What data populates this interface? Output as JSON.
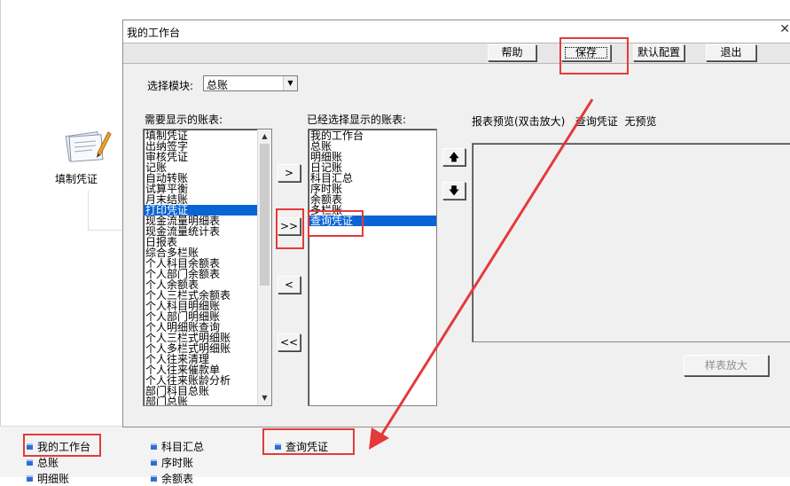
{
  "background": {
    "desktop_icon_label": "填制凭证",
    "bottom_items": [
      "我的工作台",
      "总账",
      "明细账",
      "科目汇总",
      "序时账",
      "余额表",
      "查询凭证"
    ]
  },
  "dialog": {
    "title": "我的工作台",
    "toolbar": {
      "help": "帮助",
      "save": "保存",
      "default": "默认配置",
      "exit": "退出"
    },
    "module_label": "选择模块:",
    "module_value": "总账",
    "available_label": "需要显示的账表:",
    "available_items": [
      "填制凭证",
      "出纳签字",
      "审核凭证",
      "记账",
      "自动转账",
      "试算平衡",
      "月末结账",
      "打印凭证",
      "现金流量明细表",
      "现金流量统计表",
      "日报表",
      "综合多栏账",
      "个人科目余额表",
      "个人部门余额表",
      "个人余额表",
      "个人三栏式余额表",
      "个人科目明细账",
      "个人部门明细账",
      "个人明细账查询",
      "个人三栏式明细账",
      "个人多栏式明细账",
      "个人往来清理",
      "个人往来催款单",
      "个人往来账龄分析",
      "部门科目总账",
      "部门总账"
    ],
    "available_selected": "打印凭证",
    "selected_label": "已经选择显示的账表:",
    "selected_items": [
      "我的工作台",
      "总账",
      "明细账",
      "日记账",
      "科目汇总",
      "序时账",
      "余额表",
      "多栏账",
      "查询凭证"
    ],
    "selected_selected": "查询凭证",
    "move_buttons": {
      "add": ">",
      "add_all": ">>",
      "remove": "<",
      "remove_all": "<<"
    },
    "preview_label": "报表预览(双击放大)",
    "preview_current": "查询凭证",
    "preview_status": "无预览",
    "zoom_button": "样表放大"
  },
  "colors": {
    "highlight": "#e43a3a",
    "selection": "#0a64d6"
  }
}
